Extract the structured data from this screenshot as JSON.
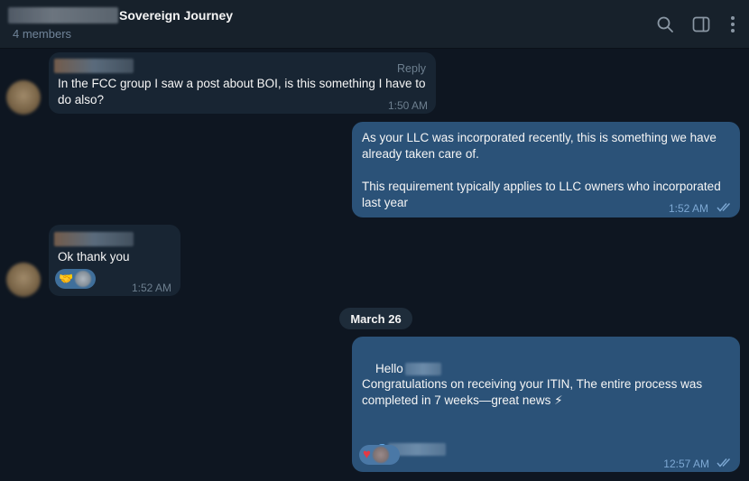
{
  "header": {
    "title": "Sovereign Journey",
    "subtitle": "4 members"
  },
  "messages": [
    {
      "reply_label": "Reply",
      "text": "In the FCC group I saw a post about BOI, is this something I have to do also?",
      "time": "1:50 AM"
    },
    {
      "text": "As your LLC was incorporated recently, this is something we have already taken care of.\n\nThis requirement typically applies to LLC owners who incorporated last year",
      "time": "1:52 AM"
    },
    {
      "text": "Ok thank you",
      "reaction_emoji": "🤝",
      "time": "1:52 AM"
    },
    {
      "greeting": "Hello",
      "body": "Congratulations on receiving your ITIN, The entire process was completed in 7 weeks—great news ⚡",
      "mention_prefix": "@",
      "reaction_emoji": "♥",
      "time": "12:57 AM"
    }
  ],
  "date_separator": "March 26",
  "colors": {
    "background": "#0e1621",
    "header": "#17212b",
    "incoming_bubble": "#182533",
    "outgoing_bubble": "#2b5278",
    "accent": "#6ab3f3"
  }
}
